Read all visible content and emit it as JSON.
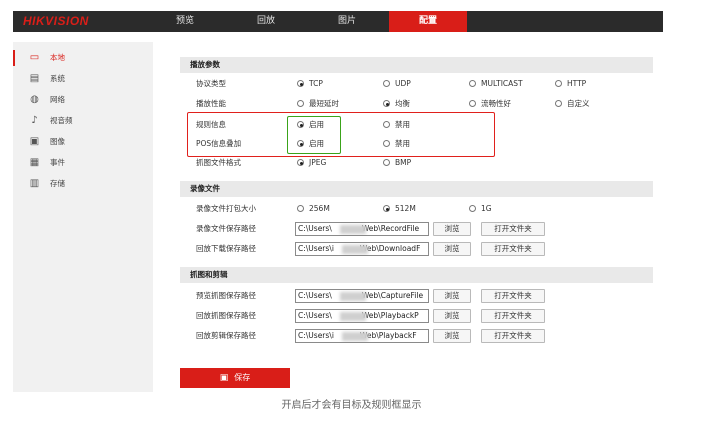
{
  "header": {
    "logo": "HIKVISION",
    "nav": [
      "预览",
      "回放",
      "图片",
      "配置"
    ]
  },
  "sidebar": {
    "items": [
      {
        "label": "本地",
        "icon": "monitor-icon"
      },
      {
        "label": "系统",
        "icon": "system-icon"
      },
      {
        "label": "网络",
        "icon": "globe-icon"
      },
      {
        "label": "视音频",
        "icon": "audio-video-icon"
      },
      {
        "label": "图像",
        "icon": "image-icon"
      },
      {
        "label": "事件",
        "icon": "calendar-icon"
      },
      {
        "label": "存储",
        "icon": "storage-icon"
      }
    ]
  },
  "playback": {
    "title": "播放参数",
    "protocol": {
      "label": "协议类型",
      "options": [
        "TCP",
        "UDP",
        "MULTICAST",
        "HTTP"
      ]
    },
    "performance": {
      "label": "播放性能",
      "options": [
        "最短延时",
        "均衡",
        "流畅性好",
        "自定义"
      ]
    },
    "rules": {
      "label": "规则信息",
      "options": [
        "启用",
        "禁用"
      ]
    },
    "pos": {
      "label": "POS信息叠加",
      "options": [
        "启用",
        "禁用"
      ]
    },
    "snapshot_format": {
      "label": "抓图文件格式",
      "options": [
        "JPEG",
        "BMP"
      ]
    }
  },
  "record": {
    "title": "录像文件",
    "pack_size": {
      "label": "录像文件打包大小",
      "options": [
        "256M",
        "512M",
        "1G"
      ]
    },
    "save_path": {
      "label": "录像文件保存路径",
      "value_start": "C:\\Users\\",
      "value_end": "Web\\RecordFile"
    },
    "download_path": {
      "label": "回放下载保存路径",
      "value_start": "C:\\Users\\i",
      "value_end": "Web\\DownloadF"
    }
  },
  "capture": {
    "title": "抓图和剪辑",
    "preview_path": {
      "label": "预览抓图保存路径",
      "value_start": "C:\\Users\\",
      "value_end": "Web\\CaptureFile"
    },
    "playback_snap_path": {
      "label": "回放抓图保存路径",
      "value_start": "C:\\Users\\",
      "value_end": "Web\\PlaybackP"
    },
    "playback_clip_path": {
      "label": "回放剪辑保存路径",
      "value_start": "C:\\Users\\i",
      "value_end": "Web\\PlaybackF"
    }
  },
  "buttons": {
    "browse": "浏览",
    "open_folder": "打开文件夹",
    "save": "保存"
  },
  "caption": "开启后才会有目标及规则框显示",
  "colors": {
    "accent": "#d91e18",
    "topbar": "#2b2b2b",
    "highlight_red": "#e0201c",
    "highlight_green": "#3aa31a"
  }
}
